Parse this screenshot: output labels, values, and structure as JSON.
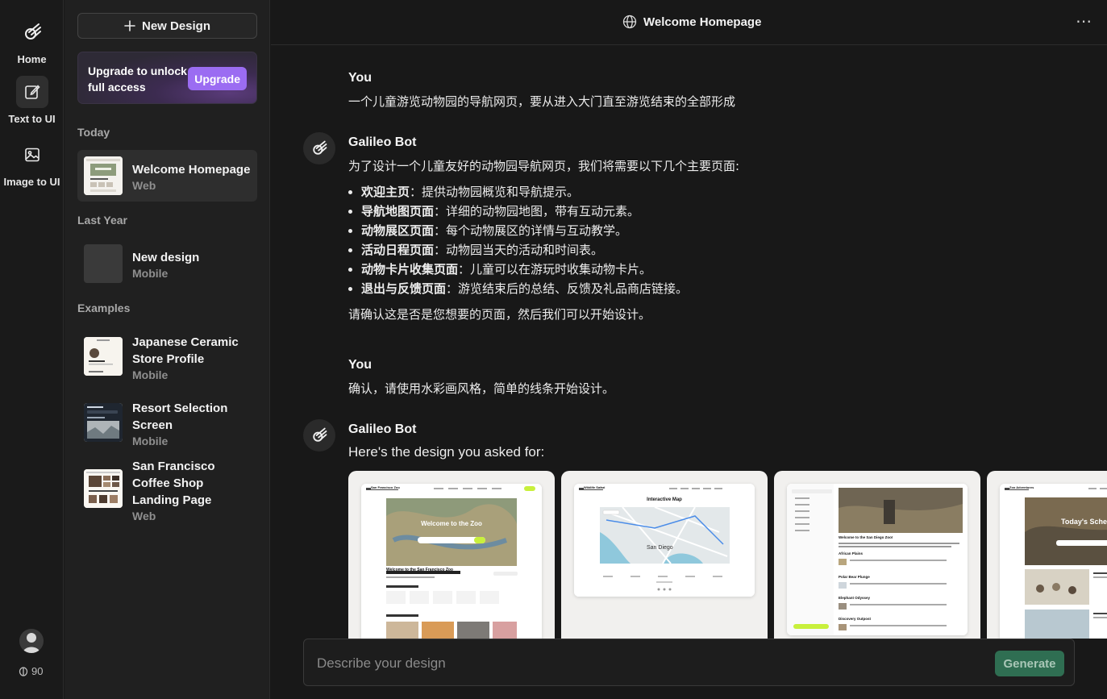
{
  "rail": {
    "items": [
      {
        "label": "Home",
        "icon": "galileo-logo-icon"
      },
      {
        "label": "Text to UI",
        "icon": "edit-icon"
      },
      {
        "label": "Image to UI",
        "icon": "image-icon"
      }
    ],
    "avatar_alt": "avat",
    "credits": "90"
  },
  "sidebar": {
    "new_design_label": "New Design",
    "upgrade": {
      "text": "Upgrade to unlock full access",
      "button": "Upgrade"
    },
    "sections": {
      "today": "Today",
      "last_year": "Last Year",
      "examples": "Examples"
    },
    "today_items": [
      {
        "name": "Welcome Homepage",
        "type": "Web"
      }
    ],
    "last_year_items": [
      {
        "name": "New design",
        "type": "Mobile"
      }
    ],
    "example_items": [
      {
        "name": "Japanese Ceramic Store Profile",
        "type": "Mobile"
      },
      {
        "name": "Resort Selection Screen",
        "type": "Mobile"
      },
      {
        "name": "San Francisco Coffee Shop Landing Page",
        "type": "Web"
      }
    ]
  },
  "header": {
    "title": "Welcome Homepage",
    "more": "⋯"
  },
  "chat": {
    "messages": [
      {
        "author": "You",
        "text": "一个儿童游览动物园的导航网页，要从进入大门直至游览结束的全部形成"
      },
      {
        "author": "Galileo Bot",
        "intro": "为了设计一个儿童友好的动物园导航网页，我们将需要以下几个主要页面:",
        "bullets": [
          {
            "title": "欢迎主页",
            "desc": "：提供动物园概览和导航提示。"
          },
          {
            "title": "导航地图页面",
            "desc": "：详细的动物园地图，带有互动元素。"
          },
          {
            "title": "动物展区页面",
            "desc": "：每个动物展区的详情与互动教学。"
          },
          {
            "title": "活动日程页面",
            "desc": "：动物园当天的活动和时间表。"
          },
          {
            "title": "动物卡片收集页面",
            "desc": "：儿童可以在游玩时收集动物卡片。"
          },
          {
            "title": "退出与反馈页面",
            "desc": "：游览结束后的总结、反馈及礼品商店链接。"
          }
        ],
        "outro": "请确认这是否是您想要的页面，然后我们可以开始设计。"
      },
      {
        "author": "You",
        "text": "确认，请使用水彩画风格，简单的线条开始设计。"
      },
      {
        "author": "Galileo Bot",
        "text": "Here's the design you asked for:"
      }
    ],
    "previews": {
      "card1": {
        "title": "Welcome to the Zoo",
        "subtitle": "Welcome to the San Francisco Zoo",
        "nav_title": "San Francisco Zoo"
      },
      "card2": {
        "title": "Interactive Map",
        "nav_title": "Wildlife Safari",
        "map_label": "San Diego"
      },
      "card3": {
        "heading": "Welcome to the San Diego Zoo!",
        "sections": [
          "African Plains",
          "Polar Bear Plunge",
          "Elephant Odyssey",
          "Discovery Outpost"
        ]
      },
      "card4": {
        "title": "Today's Sched",
        "nav_title": "Zoo Adventures"
      }
    }
  },
  "composer": {
    "placeholder": "Describe your design",
    "generate_label": "Generate"
  },
  "colors": {
    "upgrade_button": "#9b6cf2",
    "generate_button": "#2f6e52",
    "accent_lime": "#c8f03c"
  }
}
